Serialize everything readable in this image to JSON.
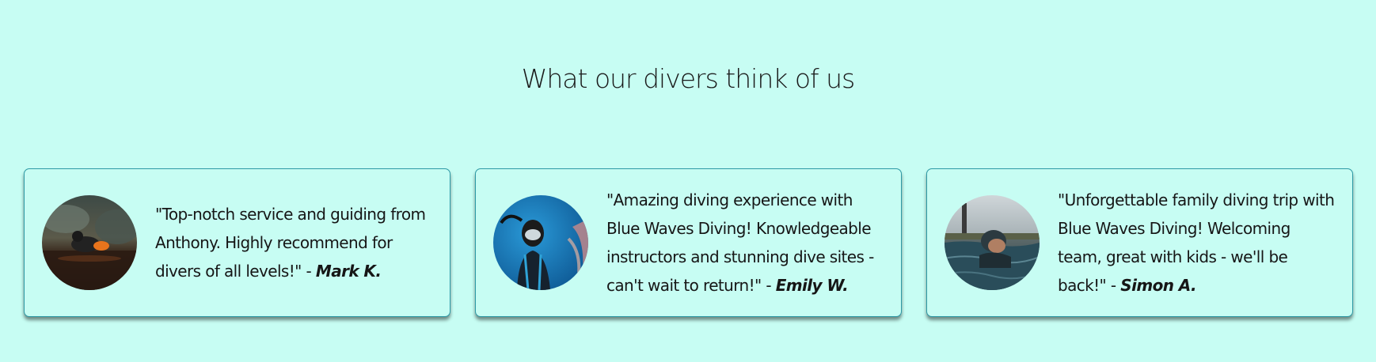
{
  "section": {
    "title": "What our divers think of us"
  },
  "testimonials": [
    {
      "quote": "\"Top-notch service and guiding from Anthony. Highly recommend for divers of all levels!\" - ",
      "author": "Mark K.",
      "photo": "diver-in-cave-photo"
    },
    {
      "quote": "\"Amazing diving experience with Blue Waves Diving! Knowledgeable instructors and stunning dive sites - can't wait to return!\" - ",
      "author": "Emily W.",
      "photo": "diver-underwater-photo"
    },
    {
      "quote": "\"Unforgettable family diving trip with Blue Waves Diving! Welcoming team, great with kids - we'll be back!\" - ",
      "author": "Simon A.",
      "photo": "swimmer-near-lighthouse-photo"
    }
  ],
  "colors": {
    "background": "#c7fdf3",
    "card_border": "#2e9aa6",
    "text": "#161616"
  }
}
